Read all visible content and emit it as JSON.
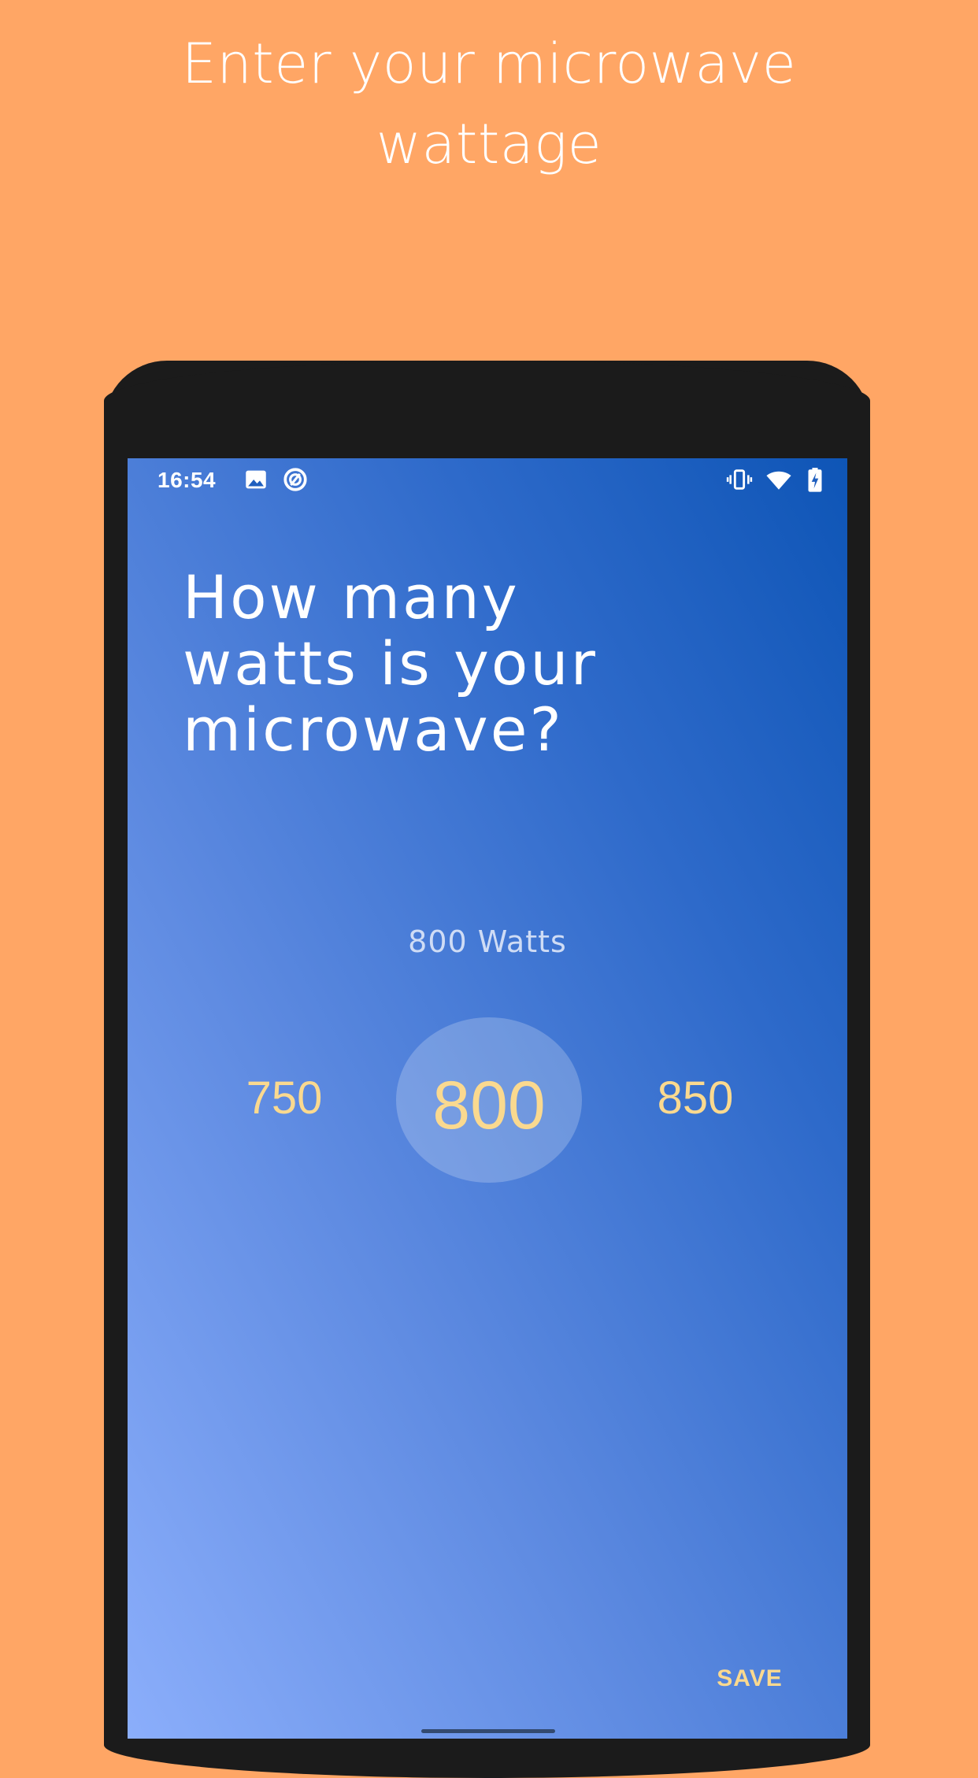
{
  "promo": {
    "title_line1": "Enter your microwave",
    "title_line2": "wattage"
  },
  "status_bar": {
    "time": "16:54",
    "left_icons": [
      "image-icon",
      "data-saver-icon"
    ],
    "right_icons": [
      "vibrate-icon",
      "wifi-icon",
      "battery-charging-icon"
    ]
  },
  "screen": {
    "question_line1": "How many",
    "question_line2": "watts is your",
    "question_line3": "microwave?",
    "watts_label": "800 Watts",
    "picker": {
      "prev": "750",
      "selected": "800",
      "next": "850"
    },
    "save_label": "SAVE"
  },
  "colors": {
    "background": "#FFA665",
    "phone_frame": "#1b1b1b",
    "gradient_top": "#0E55B6",
    "gradient_bottom": "#8BAEFB",
    "accent": "#FAD98F",
    "text": "#FFFFFF"
  }
}
